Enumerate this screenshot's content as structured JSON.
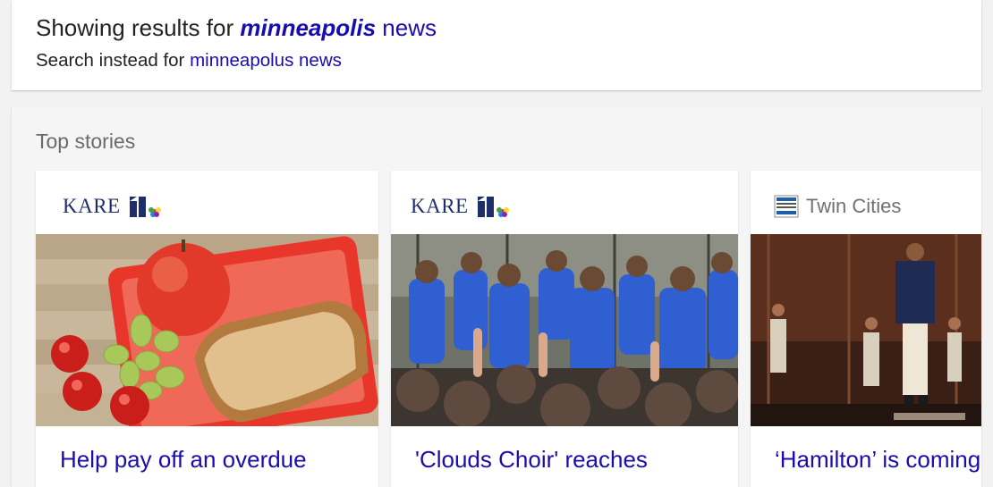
{
  "spelling": {
    "showing_prefix": "Showing results for",
    "corrected_term": "minneapolis",
    "corrected_rest": " news",
    "instead_prefix": "Search instead for",
    "original_query": "minneapolus news"
  },
  "top_stories": {
    "title": "Top stories",
    "items": [
      {
        "source": "KARE",
        "headline": "Help pay off an overdue",
        "image": "lunchbox-apple-sandwich-grapes"
      },
      {
        "source": "KARE",
        "headline": "'Clouds Choir' reaches",
        "image": "choir-in-blue-shirts-crowd"
      },
      {
        "source": "Twin Cities",
        "headline": "‘Hamilton’ is coming",
        "image": "hamilton-stage-performers"
      }
    ]
  },
  "colors": {
    "link": "#1a0dab",
    "text": "#222222",
    "muted": "#6b6b6b",
    "kare_navy": "#1e2e6b",
    "choir_blue": "#2f5fd0"
  }
}
